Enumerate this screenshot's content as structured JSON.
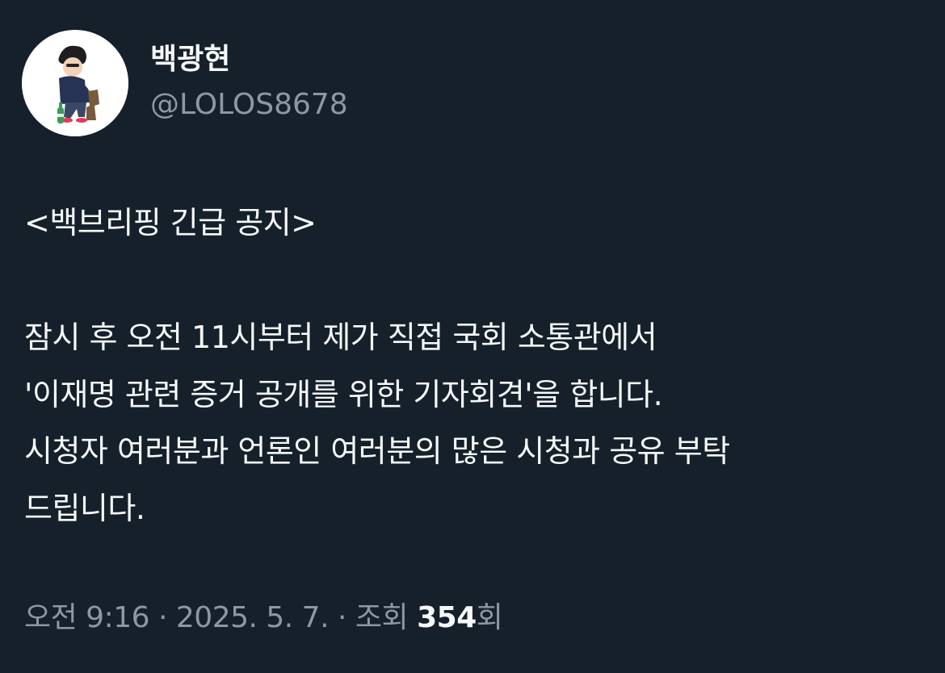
{
  "author": {
    "display_name": "백광현",
    "handle": "@LOLOS8678",
    "avatar_icon": "avatar-illustration-icon"
  },
  "tweet": {
    "headline": "<백브리핑 긴급 공지>",
    "lines": [
      "잠시 후 오전 11시부터 제가 직접 국회 소통관에서",
      "'이재명 관련 증거 공개를 위한 기자회견'을 합니다.",
      "시청자 여러분과 언론인 여러분의 많은 시청과 공유 부탁",
      "드립니다."
    ]
  },
  "meta": {
    "time": "오전 9:16",
    "separator": "·",
    "date": "2025. 5. 7.",
    "views_label": "조회",
    "views_count": "354",
    "views_suffix": "회"
  },
  "colors": {
    "background": "#15202b",
    "text_primary": "#f7f9f9",
    "text_secondary": "#8b98a5"
  }
}
